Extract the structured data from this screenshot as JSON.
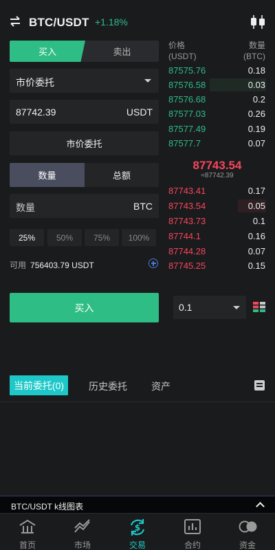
{
  "header": {
    "pair": "BTC/USDT",
    "change": "+1.18%"
  },
  "form": {
    "buy_tab": "买入",
    "sell_tab": "卖出",
    "order_type": "市价委托",
    "price_value": "87742.39",
    "price_unit": "USDT",
    "market_button": "市价委托",
    "quantity_tab": "数量",
    "total_tab": "总额",
    "amount_label": "数量",
    "amount_unit": "BTC",
    "percents": [
      "25%",
      "50%",
      "75%",
      "100%"
    ],
    "selected_percent": "25%",
    "available_label": "可用",
    "available_value": "756403.79 USDT",
    "buy_button": "买入"
  },
  "orderbook": {
    "price_header": "价格",
    "price_unit": "(USDT)",
    "amount_header": "数量",
    "amount_unit": "(BTC)",
    "bids": [
      {
        "price": "87575.76",
        "amount": "0.18"
      },
      {
        "price": "87576.58",
        "amount": "0.03"
      },
      {
        "price": "87576.68",
        "amount": "0.2"
      },
      {
        "price": "87577.03",
        "amount": "0.26"
      },
      {
        "price": "87577.49",
        "amount": "0.19"
      },
      {
        "price": "87577.7",
        "amount": "0.07"
      }
    ],
    "last_price": "87743.54",
    "last_price_sub": "≈87742.39",
    "asks": [
      {
        "price": "87743.41",
        "amount": "0.17"
      },
      {
        "price": "87743.54",
        "amount": "0.05"
      },
      {
        "price": "87743.73",
        "amount": "0.1"
      },
      {
        "price": "87744.1",
        "amount": "0.16"
      },
      {
        "price": "87744.28",
        "amount": "0.07"
      },
      {
        "price": "87745.25",
        "amount": "0.15"
      }
    ],
    "depth": "0.1"
  },
  "orders": {
    "current": "当前委托(0)",
    "history": "历史委托",
    "assets": "资产"
  },
  "kline_bar": {
    "title": "BTC/USDT k线图表"
  },
  "nav": {
    "home": "首页",
    "market": "市场",
    "trade": "交易",
    "contract": "合约",
    "funds": "资金"
  },
  "colors": {
    "green": "#2ebd85",
    "red": "#f6465d",
    "accent": "#1ec8c8"
  }
}
